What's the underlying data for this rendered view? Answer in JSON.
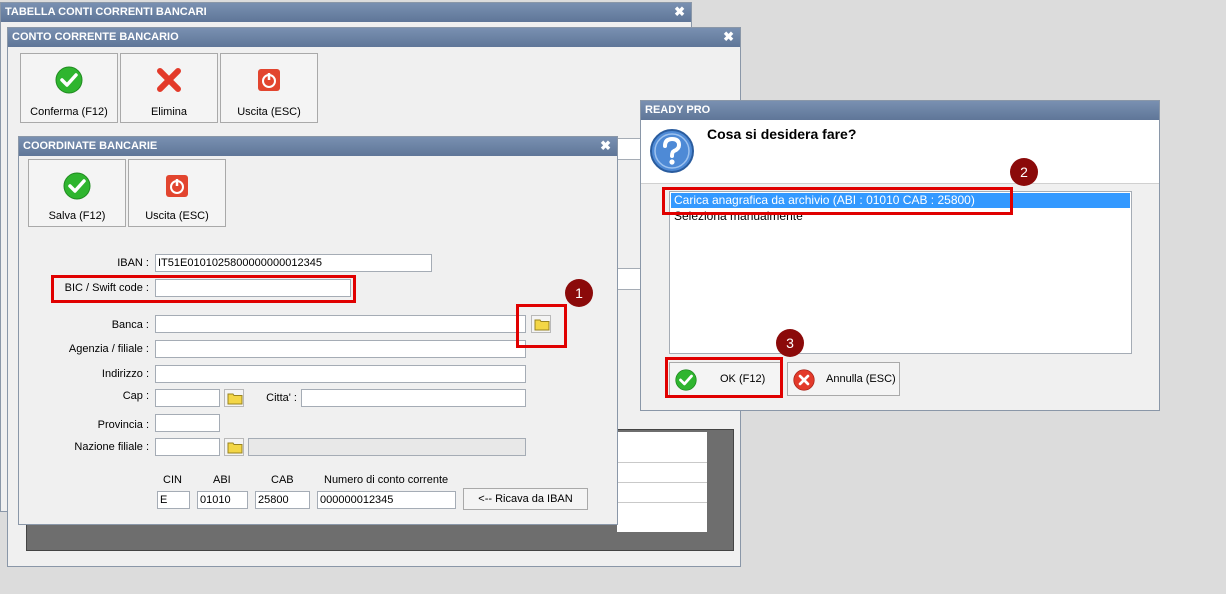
{
  "window_tabella": {
    "title": "TABELLA CONTI CORRENTI BANCARI",
    "close": "✖"
  },
  "window_conto": {
    "title": "CONTO CORRENTE BANCARIO",
    "close": "✖",
    "toolbar": {
      "confirm_label": "Conferma (F12)",
      "delete_label": "Elimina",
      "exit_label": "Uscita (ESC)"
    }
  },
  "window_coordinate": {
    "title": "COORDINATE BANCARIE",
    "close": "✖",
    "toolbar": {
      "save_label": "Salva (F12)",
      "exit_label": "Uscita (ESC)"
    },
    "fields": {
      "iban_label": "IBAN :",
      "iban_value": "IT51E0101025800000000012345",
      "bic_label": "BIC / Swift code :",
      "bic_value": "",
      "banca_label": "Banca :",
      "banca_value": "",
      "agenzia_label": "Agenzia / filiale :",
      "agenzia_value": "",
      "indirizzo_label": "Indirizzo :",
      "indirizzo_value": "",
      "cap_label": "Cap :",
      "cap_value": "",
      "citta_label": "Citta' :",
      "citta_value": "",
      "provincia_label": "Provincia :",
      "provincia_value": "",
      "nazione_label": "Nazione filiale :",
      "nazione_value": "",
      "nazione_desc": ""
    },
    "cin": {
      "header": "CIN",
      "value": "E"
    },
    "abi": {
      "header": "ABI",
      "value": "01010"
    },
    "cab": {
      "header": "CAB",
      "value": "25800"
    },
    "conto": {
      "header": "Numero di conto corrente",
      "value": "000000012345"
    },
    "ricava_label": "<-- Ricava da IBAN"
  },
  "dialog": {
    "title": "READY PRO",
    "question": "Cosa si desidera fare?",
    "options": [
      "Carica anagrafica da archivio (ABI : 01010 CAB : 25800)",
      "Seleziona manualmente"
    ],
    "selected_index": 0,
    "ok_label": "OK (F12)",
    "cancel_label": "Annulla (ESC)"
  },
  "annotations": [
    "1",
    "2",
    "3"
  ],
  "colors": {
    "title_bar": "#6b82a5",
    "highlight_box": "#e00000",
    "badge": "#8b0a0a",
    "selection": "#3399ff"
  }
}
